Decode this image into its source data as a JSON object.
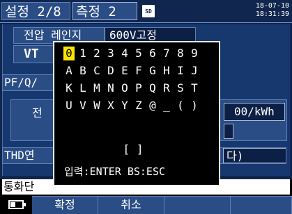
{
  "header": {
    "tabs": [
      {
        "label": "설정 2/8"
      },
      {
        "label": "측정 2"
      }
    ],
    "sd_icon_text": "SD",
    "date": "18-07-10",
    "time": "18:31:39"
  },
  "background": {
    "voltage_range_label": "전압 레인지",
    "voltage_range_value": "600V고정",
    "vt_label": "VT",
    "pf_label": "PF/Q/",
    "price_label_partial": "전",
    "price_value_partial": "00/kWh",
    "thd_label_partial": "THD연",
    "thd_value_partial": "다)",
    "status_text_partial": "통화단"
  },
  "dialog": {
    "rows": [
      [
        "0",
        "1",
        "2",
        "3",
        "4",
        "5",
        "6",
        "7",
        "8",
        "9"
      ],
      [
        "A",
        "B",
        "C",
        "D",
        "E",
        "F",
        "G",
        "H",
        "I",
        "J"
      ],
      [
        "K",
        "L",
        "M",
        "N",
        "O",
        "P",
        "Q",
        "R",
        "S",
        "T"
      ],
      [
        "U",
        "V",
        "W",
        "X",
        "Y",
        "Z",
        "@",
        "_",
        "(",
        ")"
      ]
    ],
    "selected_char": "0",
    "input_display": "[  ]",
    "hint": "입력:ENTER  BS:ESC"
  },
  "footer": {
    "buttons": [
      {
        "label": "확정"
      },
      {
        "label": "취소"
      },
      {
        "label": ""
      },
      {
        "label": ""
      }
    ],
    "battery_icon": "battery-icon"
  },
  "colors": {
    "background": "#10264e",
    "panel": "#16386f",
    "row": "#2b4d86",
    "selected": "#ffe400",
    "dialog_bg": "#000000"
  }
}
